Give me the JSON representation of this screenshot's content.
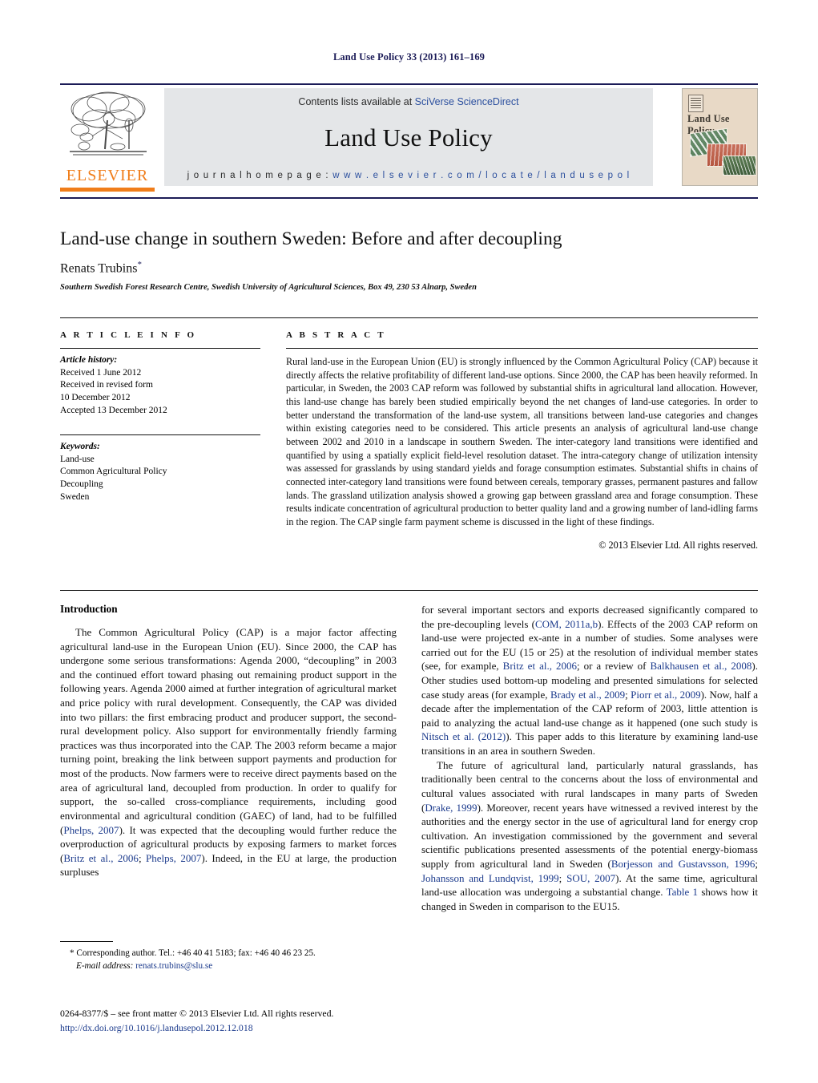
{
  "running_head": "Land Use Policy 33 (2013) 161–169",
  "masthead": {
    "contents_prefix": "Contents lists available at ",
    "contents_link": "SciVerse ScienceDirect",
    "journal_title": "Land Use Policy",
    "homepage_prefix": "j o u r n a l   h o m e p a g e :   ",
    "homepage_url": "w w w . e l s e v i e r . c o m / l o c a t e / l a n d u s e p o l",
    "publisher_name": "ELSEVIER",
    "cover_title": "Land Use Policy",
    "accent_orange": "#f07d1a",
    "link_blue": "#2b4f9e",
    "band_gray": "#e4e6e8"
  },
  "article": {
    "title": "Land-use change in southern Sweden: Before and after decoupling",
    "author": "Renats Trubins",
    "author_marker": "*",
    "affiliation": "Southern Swedish Forest Research Centre, Swedish University of Agricultural Sciences, Box 49, 230 53 Alnarp, Sweden"
  },
  "article_info": {
    "heading": "A R T I C L E   I N F O",
    "history_label": "Article history:",
    "history": [
      "Received 1 June 2012",
      "Received in revised form",
      "10 December 2012",
      "Accepted 13 December 2012"
    ],
    "keywords_label": "Keywords:",
    "keywords": [
      "Land-use",
      "Common Agricultural Policy",
      "Decoupling",
      "Sweden"
    ]
  },
  "abstract": {
    "heading": "A B S T R A C T",
    "text": "Rural land-use in the European Union (EU) is strongly influenced by the Common Agricultural Policy (CAP) because it directly affects the relative profitability of different land-use options. Since 2000, the CAP has been heavily reformed. In particular, in Sweden, the 2003 CAP reform was followed by substantial shifts in agricultural land allocation. However, this land-use change has barely been studied empirically beyond the net changes of land-use categories. In order to better understand the transformation of the land-use system, all transitions between land-use categories and changes within existing categories need to be considered. This article presents an analysis of agricultural land-use change between 2002 and 2010 in a landscape in southern Sweden. The inter-category land transitions were identified and quantified by using a spatially explicit field-level resolution dataset. The intra-category change of utilization intensity was assessed for grasslands by using standard yields and forage consumption estimates. Substantial shifts in chains of connected inter-category land transitions were found between cereals, temporary grasses, permanent pastures and fallow lands. The grassland utilization analysis showed a growing gap between grassland area and forage consumption. These results indicate concentration of agricultural production to better quality land and a growing number of land-idling farms in the region. The CAP single farm payment scheme is discussed in the light of these findings.",
    "copyright": "© 2013 Elsevier Ltd. All rights reserved."
  },
  "introduction": {
    "heading": "Introduction",
    "left_paragraphs": [
      "The Common Agricultural Policy (CAP) is a major factor affecting agricultural land-use in the European Union (EU). Since 2000, the CAP has undergone some serious transformations: Agenda 2000, “decoupling” in 2003 and the continued effort toward phasing out remaining product support in the following years. Agenda 2000 aimed at further integration of agricultural market and price policy with rural development. Consequently, the CAP was divided into two pillars: the first embracing product and producer support, the second-rural development policy. Also support for environmentally friendly farming practices was thus incorporated into the CAP. The 2003 reform became a major turning point, breaking the link between support payments and production for most of the products. Now farmers were to receive direct payments based on the area of agricultural land, decoupled from production. In order to qualify for support, the so-called cross-compliance requirements, including good environmental and agricultural condition (GAEC) of land, had to be fulfilled (Phelps, 2007). It was expected that the decoupling would further reduce the overproduction of agricultural products by exposing farmers to market forces (Britz et al., 2006; Phelps, 2007). Indeed, in the EU at large, the production surpluses"
    ],
    "right_paragraphs": [
      "for several important sectors and exports decreased significantly compared to the pre-decoupling levels (COM, 2011a,b). Effects of the 2003 CAP reform on land-use were projected ex-ante in a number of studies. Some analyses were carried out for the EU (15 or 25) at the resolution of individual member states (see, for example, Britz et al., 2006; or a review of Balkhausen et al., 2008). Other studies used bottom-up modeling and presented simulations for selected case study areas (for example, Brady et al., 2009; Piorr et al., 2009). Now, half a decade after the implementation of the CAP reform of 2003, little attention is paid to analyzing the actual land-use change as it happened (one such study is Nitsch et al. (2012)). This paper adds to this literature by examining land-use transitions in an area in southern Sweden.",
      "The future of agricultural land, particularly natural grasslands, has traditionally been central to the concerns about the loss of environmental and cultural values associated with rural landscapes in many parts of Sweden (Drake, 1999). Moreover, recent years have witnessed a revived interest by the authorities and the energy sector in the use of agricultural land for energy crop cultivation. An investigation commissioned by the government and several scientific publications presented assessments of the potential energy-biomass supply from agricultural land in Sweden (Borjesson and Gustavsson, 1996; Johansson and Lundqvist, 1999; SOU, 2007). At the same time, agricultural land-use allocation was undergoing a substantial change. Table 1 shows how it changed in Sweden in comparison to the EU15."
    ],
    "citations_left": [
      "Phelps, 2007",
      "Britz et al., 2006",
      "Phelps, 2007"
    ],
    "citations_right": [
      "COM, 2011a,b",
      "Britz et al., 2006",
      "Balkhausen et al., 2008",
      "Brady et al., 2009",
      "Piorr et al., 2009",
      "Nitsch et al. (2012)",
      "Drake, 1999",
      "Borjesson and Gustavsson, 1996",
      "Johansson and Lundqvist, 1999",
      "SOU, 2007",
      "Table 1"
    ]
  },
  "footnote": {
    "marker": "*",
    "corresponding": "Corresponding author. Tel.: +46 40 41 5183; fax: +46 40 46 23 25.",
    "email_label": "E-mail address:",
    "email": "renats.trubins@slu.se"
  },
  "colophon": {
    "front_matter": "0264-8377/$ – see front matter © 2013 Elsevier Ltd. All rights reserved.",
    "doi": "http://dx.doi.org/10.1016/j.landusepol.2012.12.018"
  }
}
